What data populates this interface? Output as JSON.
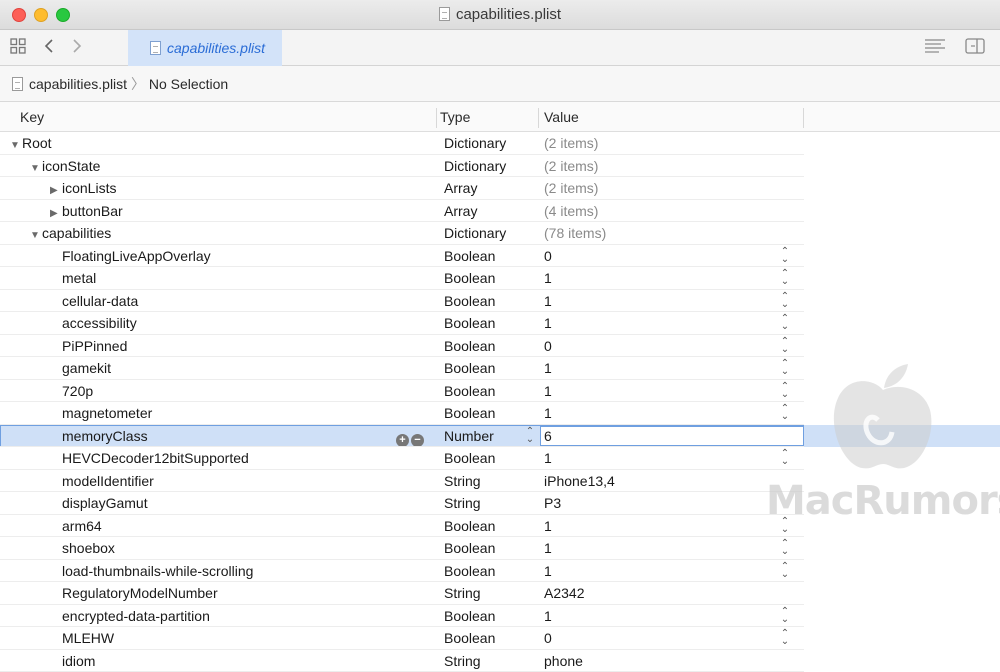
{
  "window": {
    "title": "capabilities.plist"
  },
  "toolbar": {
    "tab_label": "capabilities.plist"
  },
  "pathbar": {
    "file": "capabilities.plist",
    "separator": "〉",
    "selection": "No Selection"
  },
  "columns": {
    "key": "Key",
    "type": "Type",
    "value": "Value"
  },
  "rows": [
    {
      "key": "Root",
      "type": "Dictionary",
      "value": "(2 items)",
      "indent": 0,
      "disclosure": "open",
      "muted": true
    },
    {
      "key": "iconState",
      "type": "Dictionary",
      "value": "(2 items)",
      "indent": 1,
      "disclosure": "open",
      "muted": true
    },
    {
      "key": "iconLists",
      "type": "Array",
      "value": "(2 items)",
      "indent": 2,
      "disclosure": "closed",
      "muted": true
    },
    {
      "key": "buttonBar",
      "type": "Array",
      "value": "(4 items)",
      "indent": 2,
      "disclosure": "closed",
      "muted": true
    },
    {
      "key": "capabilities",
      "type": "Dictionary",
      "value": "(78 items)",
      "indent": 1,
      "disclosure": "open",
      "muted": true
    },
    {
      "key": "FloatingLiveAppOverlay",
      "type": "Boolean",
      "value": "0",
      "indent": 3,
      "stepper": true
    },
    {
      "key": "metal",
      "type": "Boolean",
      "value": "1",
      "indent": 3,
      "stepper": true
    },
    {
      "key": "cellular-data",
      "type": "Boolean",
      "value": "1",
      "indent": 3,
      "stepper": true
    },
    {
      "key": "accessibility",
      "type": "Boolean",
      "value": "1",
      "indent": 3,
      "stepper": true
    },
    {
      "key": "PiPPinned",
      "type": "Boolean",
      "value": "0",
      "indent": 3,
      "stepper": true
    },
    {
      "key": "gamekit",
      "type": "Boolean",
      "value": "1",
      "indent": 3,
      "stepper": true
    },
    {
      "key": "720p",
      "type": "Boolean",
      "value": "1",
      "indent": 3,
      "stepper": true
    },
    {
      "key": "magnetometer",
      "type": "Boolean",
      "value": "1",
      "indent": 3,
      "stepper": true
    },
    {
      "key": "memoryClass",
      "type": "Number",
      "value": "6",
      "indent": 3,
      "selected": true
    },
    {
      "key": "HEVCDecoder12bitSupported",
      "type": "Boolean",
      "value": "1",
      "indent": 3,
      "stepper": true
    },
    {
      "key": "modelIdentifier",
      "type": "String",
      "value": "iPhone13,4",
      "indent": 3
    },
    {
      "key": "displayGamut",
      "type": "String",
      "value": "P3",
      "indent": 3
    },
    {
      "key": "arm64",
      "type": "Boolean",
      "value": "1",
      "indent": 3,
      "stepper": true
    },
    {
      "key": "shoebox",
      "type": "Boolean",
      "value": "1",
      "indent": 3,
      "stepper": true
    },
    {
      "key": "load-thumbnails-while-scrolling",
      "type": "Boolean",
      "value": "1",
      "indent": 3,
      "stepper": true
    },
    {
      "key": "RegulatoryModelNumber",
      "type": "String",
      "value": "A2342",
      "indent": 3
    },
    {
      "key": "encrypted-data-partition",
      "type": "Boolean",
      "value": "1",
      "indent": 3,
      "stepper": true
    },
    {
      "key": "MLEHW",
      "type": "Boolean",
      "value": "0",
      "indent": 3,
      "stepper": true
    },
    {
      "key": "idiom",
      "type": "String",
      "value": "phone",
      "indent": 3
    }
  ],
  "watermark": {
    "text": "MacRumors"
  }
}
